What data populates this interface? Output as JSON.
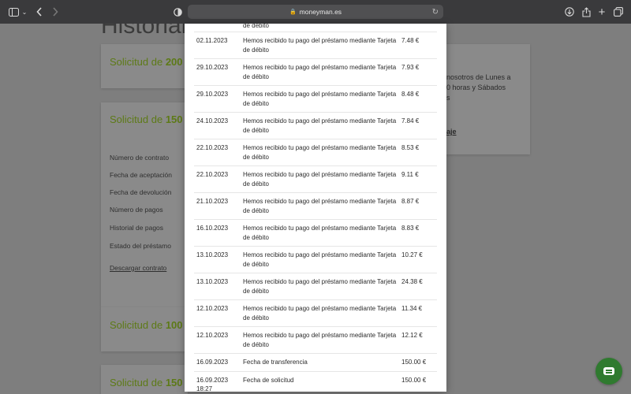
{
  "browser": {
    "url": "moneyman.es"
  },
  "page": {
    "title": "Historial",
    "cards": [
      {
        "title_prefix": "Solicitud de ",
        "title_amount": "200"
      },
      {
        "title_prefix": "Solicitud de ",
        "title_amount": "150"
      },
      {
        "title_prefix": "Solicitud de ",
        "title_amount": "100"
      },
      {
        "title_prefix": "Solicitud de ",
        "title_amount": "150"
      }
    ],
    "fields": [
      "Número de contrato",
      "Fecha de aceptación",
      "Fecha de devolución",
      "Número de pagos",
      "Historial de pagos",
      "Estado del préstamo"
    ],
    "download_link": "Descargar contrato",
    "side_text": [
      "nosotros de Lunes a",
      "0 horas y Sábados",
      "s"
    ],
    "side_link": "aje"
  },
  "payments": [
    {
      "date": "",
      "desc": "de débito",
      "amount": ""
    },
    {
      "date": "02.11.2023",
      "desc": "Hemos recibido tu pago del préstamo mediante Tarjeta de débito",
      "amount": "7.48 €"
    },
    {
      "date": "29.10.2023",
      "desc": "Hemos recibido tu pago del préstamo mediante Tarjeta de débito",
      "amount": "7.93 €"
    },
    {
      "date": "29.10.2023",
      "desc": "Hemos recibido tu pago del préstamo mediante Tarjeta de débito",
      "amount": "8.48 €"
    },
    {
      "date": "24.10.2023",
      "desc": "Hemos recibido tu pago del préstamo mediante Tarjeta de débito",
      "amount": "7.84 €"
    },
    {
      "date": "22.10.2023",
      "desc": "Hemos recibido tu pago del préstamo mediante Tarjeta de débito",
      "amount": "8.53 €"
    },
    {
      "date": "22.10.2023",
      "desc": "Hemos recibido tu pago del préstamo mediante Tarjeta de débito",
      "amount": "9.11 €"
    },
    {
      "date": "21.10.2023",
      "desc": "Hemos recibido tu pago del préstamo mediante Tarjeta de débito",
      "amount": "8.87 €"
    },
    {
      "date": "16.10.2023",
      "desc": "Hemos recibido tu pago del préstamo mediante Tarjeta de débito",
      "amount": "8.83 €"
    },
    {
      "date": "13.10.2023",
      "desc": "Hemos recibido tu pago del préstamo mediante Tarjeta de débito",
      "amount": "10.27 €"
    },
    {
      "date": "13.10.2023",
      "desc": "Hemos recibido tu pago del préstamo mediante Tarjeta de débito",
      "amount": "24.38 €"
    },
    {
      "date": "12.10.2023",
      "desc": "Hemos recibido tu pago del préstamo mediante Tarjeta de débito",
      "amount": "11.34 €"
    },
    {
      "date": "12.10.2023",
      "desc": "Hemos recibido tu pago del préstamo mediante Tarjeta de débito",
      "amount": "12.12 €"
    },
    {
      "date": "16.09.2023",
      "desc": "Fecha de transferencia",
      "amount": "150.00 €"
    },
    {
      "date": "16.09.2023 18:27",
      "desc": "Fecha de solicitud",
      "amount": "150.00 €"
    }
  ]
}
